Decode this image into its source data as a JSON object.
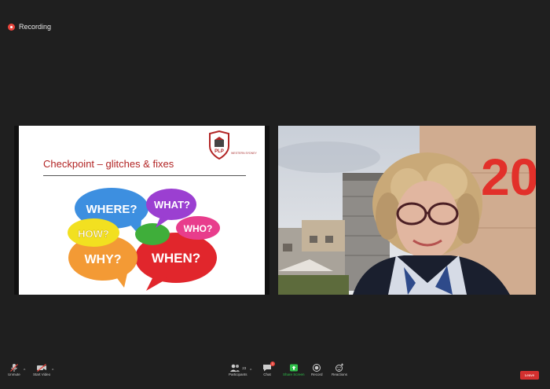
{
  "recording": {
    "label": "Recording"
  },
  "slide": {
    "title": "Checkpoint – glitches & fixes",
    "logo_initials": "PLP",
    "logo_text": "WESTERN SYDNEY",
    "bubbles": [
      "WHERE?",
      "WHAT?",
      "HOW?",
      "WHO?",
      "WHY?",
      "WHEN?"
    ]
  },
  "video": {
    "wall_number": "20"
  },
  "toolbar": {
    "unmute_label": "Unmute",
    "start_video_label": "Start Video",
    "participants_label": "Participants",
    "participants_count": "23",
    "chat_label": "Chat",
    "chat_badge": "1",
    "share_screen_label": "Share Screen",
    "record_label": "Record",
    "reactions_label": "Reactions",
    "leave_label": "Leave"
  },
  "colors": {
    "background": "#1f1f1f",
    "slide_title": "#b22525",
    "share_green": "#2fbf4a",
    "leave_red": "#d3302f"
  }
}
